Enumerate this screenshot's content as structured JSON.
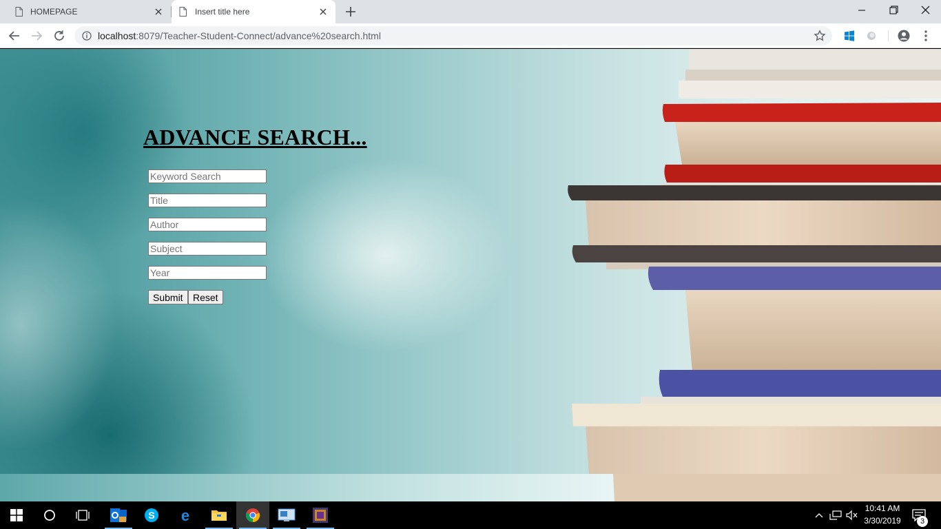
{
  "browser": {
    "tabs": [
      {
        "label": "HOMEPAGE",
        "active": false
      },
      {
        "label": "Insert title here",
        "active": true
      }
    ],
    "url_host": "localhost",
    "url_rest": ":8079/Teacher-Student-Connect/advance%20search.html"
  },
  "page": {
    "heading": "ADVANCE SEARCH...",
    "fields": {
      "keyword_placeholder": "Keyword Search",
      "title_placeholder": "Title",
      "author_placeholder": "Author",
      "subject_placeholder": "Subject",
      "year_placeholder": "Year"
    },
    "submit_label": "Submit",
    "reset_label": "Reset"
  },
  "taskbar": {
    "apps": [
      "start-icon",
      "cortana-icon",
      "task-view-icon",
      "outlook-icon",
      "skype-icon",
      "edge-icon",
      "file-explorer-icon",
      "chrome-icon",
      "remote-desktop-icon",
      "app-icon"
    ],
    "time": "10:41 AM",
    "date": "3/30/2019",
    "notifications": "3"
  },
  "colors": {
    "teal_background": "#6fb2b4",
    "chrome_tabstrip": "#dee1e6",
    "taskbar": "#000000"
  }
}
